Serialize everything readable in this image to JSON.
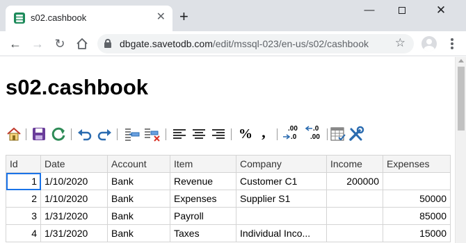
{
  "browser": {
    "tab_title": "s02.cashbook",
    "tab_close": "✕",
    "new_tab": "+",
    "url_host": "dbgate.savetodb.com",
    "url_path": "/edit/mssql-023/en-us/s02/cashbook"
  },
  "page": {
    "title": "s02.cashbook"
  },
  "toolbar": {
    "percent": "%",
    "comma": ",",
    "inc_decimal_top": ".00",
    "inc_decimal_bottom": ".0",
    "dec_decimal_top": ".0",
    "dec_decimal_bottom": ".00"
  },
  "table": {
    "columns": [
      "Id",
      "Date",
      "Account",
      "Item",
      "Company",
      "Income",
      "Expenses"
    ],
    "rows": [
      {
        "id": "1",
        "date": "1/10/2020",
        "account": "Bank",
        "item": "Revenue",
        "company": "Customer C1",
        "income": "200000",
        "expenses": ""
      },
      {
        "id": "2",
        "date": "1/10/2020",
        "account": "Bank",
        "item": "Expenses",
        "company": "Supplier S1",
        "income": "",
        "expenses": "50000"
      },
      {
        "id": "3",
        "date": "1/31/2020",
        "account": "Bank",
        "item": "Payroll",
        "company": "",
        "income": "",
        "expenses": "85000"
      },
      {
        "id": "4",
        "date": "1/31/2020",
        "account": "Bank",
        "item": "Taxes",
        "company": "Individual Inco...",
        "income": "",
        "expenses": "15000"
      }
    ]
  }
}
